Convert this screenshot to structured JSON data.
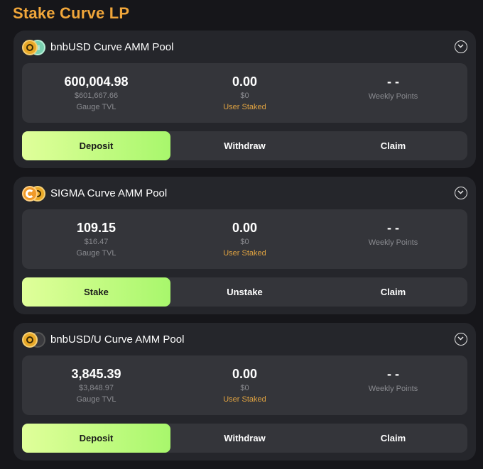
{
  "page": {
    "title": "Stake Curve LP"
  },
  "pools": [
    {
      "name": "bnbUSD Curve AMM Pool",
      "icons": [
        "bnbusd-coin-icon",
        "usdt-coin-icon"
      ],
      "gauge_tvl": "600,004.98",
      "gauge_tvl_usd": "$601,667.66",
      "gauge_tvl_label": "Gauge TVL",
      "user_staked": "0.00",
      "user_staked_usd": "$0",
      "user_staked_label": "User Staked",
      "weekly_points": "- -",
      "weekly_points_label": "Weekly Points",
      "actions": [
        "Deposit",
        "Withdraw",
        "Claim"
      ],
      "active_action": "Deposit"
    },
    {
      "name": "SIGMA Curve AMM Pool",
      "icons": [
        "sigma-coin-icon",
        "bnbusd-coin-icon"
      ],
      "gauge_tvl": "109.15",
      "gauge_tvl_usd": "$16.47",
      "gauge_tvl_label": "Gauge TVL",
      "user_staked": "0.00",
      "user_staked_usd": "$0",
      "user_staked_label": "User Staked",
      "weekly_points": "- -",
      "weekly_points_label": "Weekly Points",
      "actions": [
        "Stake",
        "Unstake",
        "Claim"
      ],
      "active_action": "Stake"
    },
    {
      "name": "bnbUSD/U Curve AMM Pool",
      "icons": [
        "bnbusd-coin-icon",
        "u-coin-icon"
      ],
      "gauge_tvl": "3,845.39",
      "gauge_tvl_usd": "$3,848.97",
      "gauge_tvl_label": "Gauge TVL",
      "user_staked": "0.00",
      "user_staked_usd": "$0",
      "user_staked_label": "User Staked",
      "weekly_points": "- -",
      "weekly_points_label": "Weekly Points",
      "actions": [
        "Deposit",
        "Withdraw",
        "Claim"
      ],
      "active_action": "Deposit"
    }
  ],
  "colors": {
    "background": "#16161a",
    "card": "#25262b",
    "panel": "#34353a",
    "title": "#f0a63a",
    "accent_label": "#e0a341",
    "active_button_start": "#e0ff9a",
    "active_button_end": "#a8f76c"
  }
}
